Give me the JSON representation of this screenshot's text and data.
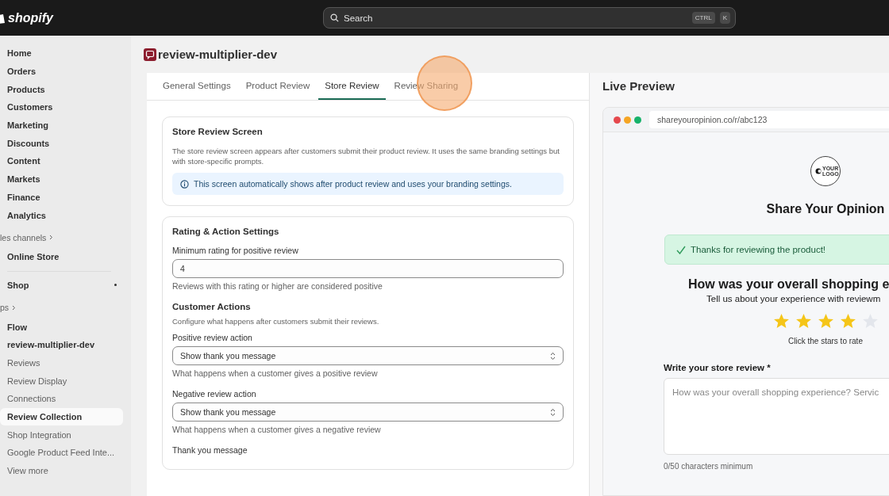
{
  "topbar": {
    "logo_text": "shopify",
    "search": {
      "placeholder": "Search",
      "keys": [
        "CTRL",
        "K"
      ]
    }
  },
  "sidebar": {
    "items": [
      {
        "kind": "nav",
        "label": "Home",
        "selected": false
      },
      {
        "kind": "nav",
        "label": "Orders",
        "selected": false
      },
      {
        "kind": "nav",
        "label": "Products",
        "selected": false
      },
      {
        "kind": "nav",
        "label": "Customers",
        "selected": false
      },
      {
        "kind": "nav",
        "label": "Marketing",
        "selected": false
      },
      {
        "kind": "nav",
        "label": "Discounts",
        "selected": false
      },
      {
        "kind": "nav",
        "label": "Content",
        "selected": false
      },
      {
        "kind": "nav",
        "label": "Markets",
        "selected": false
      },
      {
        "kind": "nav",
        "label": "Finance",
        "selected": false
      },
      {
        "kind": "nav",
        "label": "Analytics",
        "selected": false
      },
      {
        "kind": "header",
        "label": "les channels"
      },
      {
        "kind": "nav",
        "label": "Online Store",
        "selected": false
      },
      {
        "kind": "divider"
      },
      {
        "kind": "nav",
        "label": "Shop",
        "selected": false,
        "dot": true
      },
      {
        "kind": "header",
        "label": "ps"
      },
      {
        "kind": "nav",
        "label": "Flow",
        "selected": false
      },
      {
        "kind": "nav",
        "label": "review-multiplier-dev",
        "selected": false
      },
      {
        "kind": "sub",
        "label": "Reviews",
        "selected": false
      },
      {
        "kind": "sub",
        "label": "Review Display",
        "selected": false
      },
      {
        "kind": "sub",
        "label": "Connections",
        "selected": false
      },
      {
        "kind": "sub",
        "label": "Review Collection",
        "selected": true
      },
      {
        "kind": "sub",
        "label": "Shop Integration",
        "selected": false
      },
      {
        "kind": "sub",
        "label": "Google Product Feed Inte...",
        "selected": false
      },
      {
        "kind": "sub",
        "label": "View more",
        "selected": false
      }
    ]
  },
  "page": {
    "title": "review-multiplier-dev",
    "tabs": [
      {
        "label": "General Settings",
        "selected": false
      },
      {
        "label": "Product Review",
        "selected": false
      },
      {
        "label": "Store Review",
        "selected": true
      },
      {
        "label": "Review Sharing",
        "selected": false,
        "click_highlight": true
      }
    ],
    "cards": [
      {
        "title": "Store Review Screen",
        "fields": [
          {
            "kind": "text",
            "text": "The store review screen appears after customers submit their product review. It uses the same branding settings but with store-specific prompts."
          },
          {
            "kind": "info",
            "text": "This screen automatically shows after product review and uses your branding settings."
          }
        ]
      },
      {
        "title": "Rating & Action Settings",
        "fields": [
          {
            "kind": "label",
            "text": "Minimum rating for positive review"
          },
          {
            "kind": "input",
            "value": "4"
          },
          {
            "kind": "help",
            "text": "Reviews with this rating or higher are considered positive"
          },
          {
            "kind": "heading",
            "text": "Customer Actions"
          },
          {
            "kind": "text",
            "text": "Configure what happens after customers submit their reviews."
          },
          {
            "kind": "label",
            "text": "Positive review action"
          },
          {
            "kind": "select",
            "value": "Show thank you message"
          },
          {
            "kind": "help",
            "text": "What happens when a customer gives a positive review"
          },
          {
            "kind": "label",
            "text": "Negative review action"
          },
          {
            "kind": "select",
            "value": "Show thank you message"
          },
          {
            "kind": "help",
            "text": "What happens when a customer gives a negative review"
          },
          {
            "kind": "label",
            "text": "Thank you message"
          }
        ]
      }
    ]
  },
  "preview": {
    "title": "Live Preview",
    "url": "shareyouropinion.co/r/abc123",
    "logo_text": "YOUR LOGO",
    "heading": "Share Your Opinion",
    "success": "Thanks for reviewing the product!",
    "question": "How was your overall shopping e",
    "subtitle": "Tell us about your experience with reviewm",
    "stars": 4,
    "stars_hint": "Click the stars to rate",
    "review_label": "Write your store review *",
    "review_placeholder": "How was your overall shopping experience? Servic",
    "counter": "0/50 characters minimum"
  }
}
